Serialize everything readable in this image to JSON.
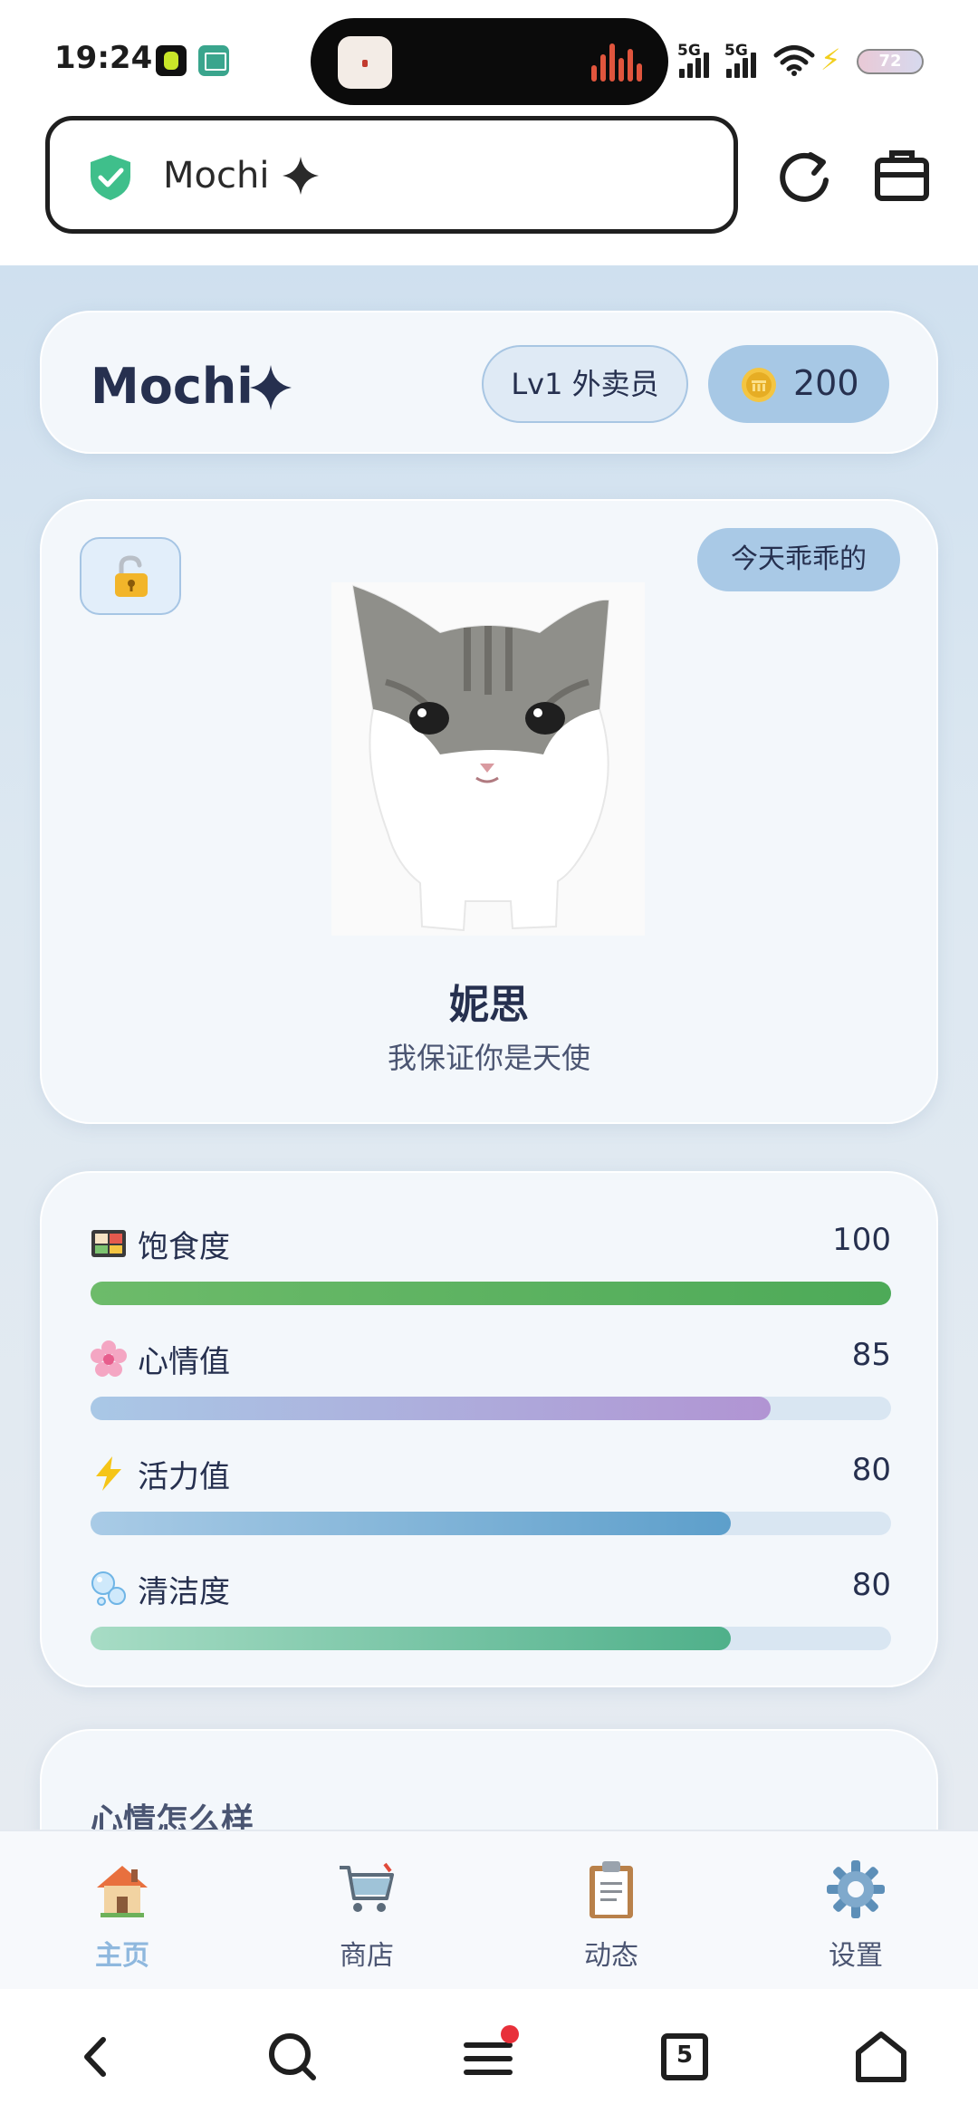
{
  "status_bar": {
    "time": "19:24",
    "network_labels": [
      "5G",
      "5G"
    ],
    "battery_level": "72"
  },
  "address_bar": {
    "site_title": "Mochi"
  },
  "header": {
    "brand": "Mochi",
    "level": "Lv1 外卖员",
    "coins": "200"
  },
  "pet": {
    "mood_tag": "今天乖乖的",
    "name": "妮思",
    "motto": "我保证你是天使"
  },
  "stats": [
    {
      "label": "饱食度",
      "value": "100",
      "percent": 100,
      "icon": "bento-icon",
      "color_from": "#6dbb6a",
      "color_to": "#4daa58"
    },
    {
      "label": "心情值",
      "value": "85",
      "percent": 85,
      "icon": "blossom-icon",
      "color_from": "#a9c8e6",
      "color_to": "#b194d3"
    },
    {
      "label": "活力值",
      "value": "80",
      "percent": 80,
      "icon": "lightning-icon",
      "color_from": "#a9cbe6",
      "color_to": "#5d9fcb"
    },
    {
      "label": "清洁度",
      "value": "80",
      "percent": 80,
      "icon": "bubbles-icon",
      "color_from": "#a7dcc5",
      "color_to": "#4fb08a"
    }
  ],
  "mood_section": {
    "title": "心情怎么样"
  },
  "tabs": [
    {
      "label": "主页",
      "icon": "house-icon",
      "active": true
    },
    {
      "label": "商店",
      "icon": "cart-icon",
      "active": false
    },
    {
      "label": "动态",
      "icon": "clipboard-icon",
      "active": false
    },
    {
      "label": "设置",
      "icon": "gear-icon",
      "active": false
    }
  ],
  "system_nav": {
    "tab_count": "5"
  },
  "colors": {
    "accent": "#a7c8e5",
    "active_tab": "#8fb8de",
    "text_dark": "#26304f"
  }
}
